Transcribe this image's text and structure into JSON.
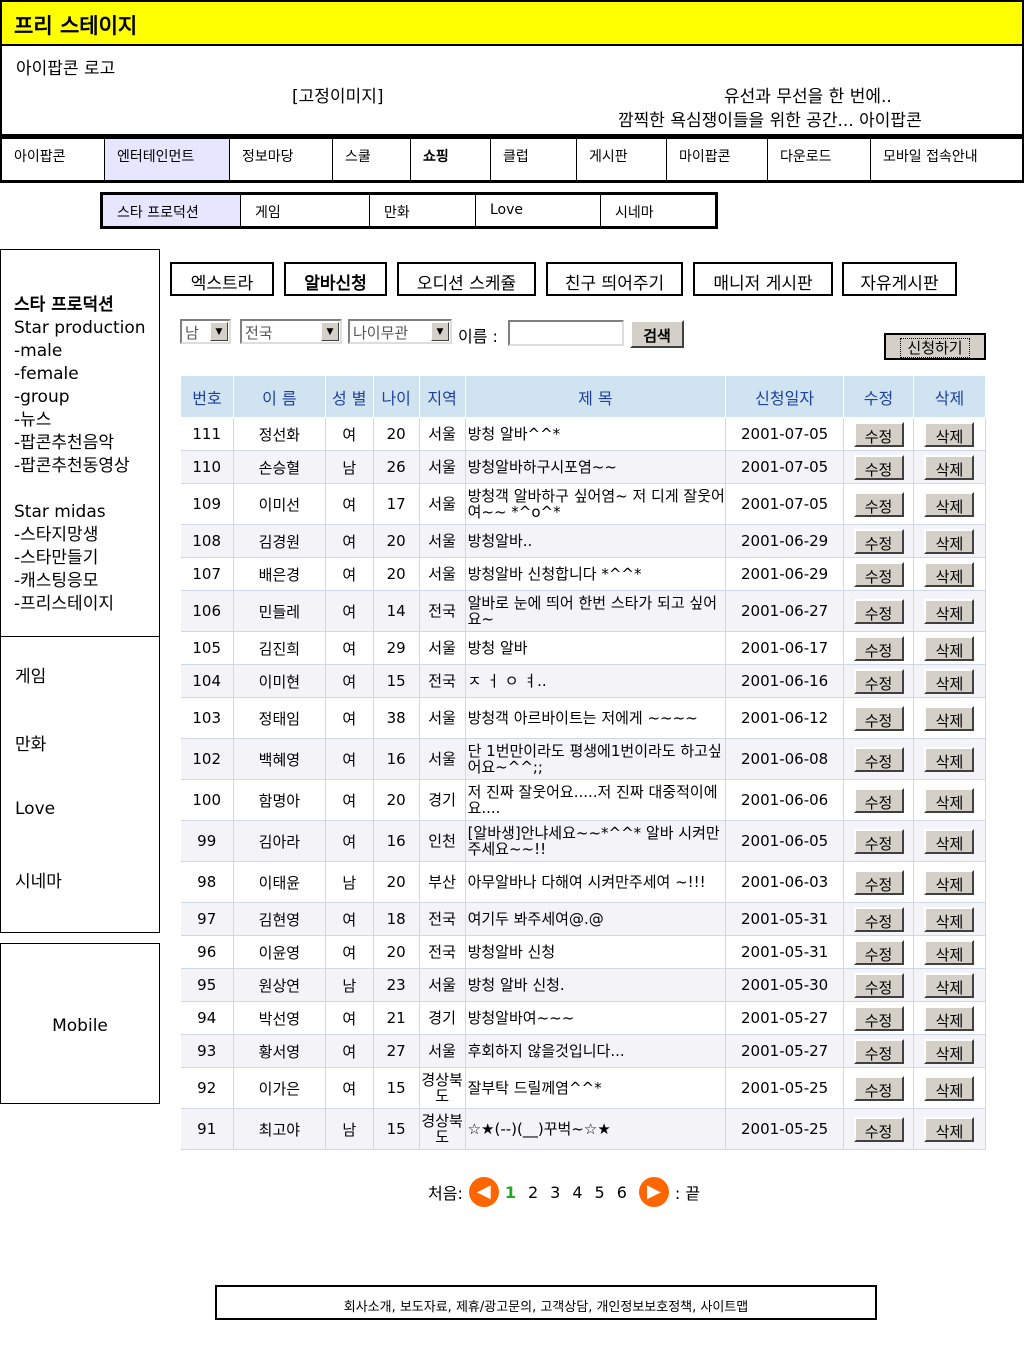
{
  "site_title": "프리 스테이지",
  "header": {
    "logo_label": "아이팝콘 로고",
    "fixed_image": "[고정이미지]",
    "slogan_line1": "유선과 무선을 한 번에..",
    "slogan_line2": "깜찍한 욕심쟁이들을 위한 공간... 아이팝콘"
  },
  "main_nav": [
    "아이팝콘",
    "엔터테인먼트",
    "정보마당",
    "스쿨",
    "쇼핑",
    "클럽",
    "게시판",
    "마이팝콘",
    "다운로드",
    "모바일 접속안내"
  ],
  "sub_nav": [
    "스타 프로덕션",
    "게임",
    "만화",
    "Love",
    "시네마"
  ],
  "sidebar": {
    "title": "스타 프로덕션",
    "group1": [
      "Star production",
      "-male",
      "-female",
      "-group",
      "-뉴스",
      "-팝콘추천음악",
      "-팝콘추천동영상"
    ],
    "group2": [
      "Star midas",
      "-스타지망생",
      "-스타만들기",
      "-캐스팅응모",
      "-프리스테이지"
    ],
    "menu": [
      "게임",
      "만화",
      "Love",
      "시네마"
    ],
    "mobile": "Mobile"
  },
  "tabs": [
    "엑스트라",
    "알바신청",
    "오디션 스케쥴",
    "친구 띄어주기",
    "매니저 게시판",
    "자유게시판"
  ],
  "filters": {
    "gender": "남",
    "region": "전국",
    "age": "나이무관",
    "name_label": "이름 :",
    "search_label": "검색",
    "apply_label": "신청하기"
  },
  "table": {
    "headers": [
      "번호",
      "이 름",
      "성 별",
      "나이",
      "지역",
      "제 목",
      "신청일자",
      "수정",
      "삭제"
    ],
    "edit_label": "수정",
    "delete_label": "삭제",
    "rows": [
      {
        "no": "111",
        "name": "정선화",
        "gender": "여",
        "age": "20",
        "region": "서울",
        "title": "방청 알바^^*",
        "date": "2001-07-05"
      },
      {
        "no": "110",
        "name": "손승혈",
        "gender": "남",
        "age": "26",
        "region": "서울",
        "title": "방청알바하구시포염~~",
        "date": "2001-07-05"
      },
      {
        "no": "109",
        "name": "이미선",
        "gender": "여",
        "age": "17",
        "region": "서울",
        "title": "방청객 알바하구 싶어염~ 저 디게 잘웃어여~~ *^o^*",
        "date": "2001-07-05"
      },
      {
        "no": "108",
        "name": "김경원",
        "gender": "여",
        "age": "20",
        "region": "서울",
        "title": "방청알바..",
        "date": "2001-06-29"
      },
      {
        "no": "107",
        "name": "배은경",
        "gender": "여",
        "age": "20",
        "region": "서울",
        "title": "방청알바 신청합니다 *^^*",
        "date": "2001-06-29"
      },
      {
        "no": "106",
        "name": "민들레",
        "gender": "여",
        "age": "14",
        "region": "전국",
        "title": "알바로 눈에 띄어 한번 스타가 되고 싶어요~",
        "date": "2001-06-27"
      },
      {
        "no": "105",
        "name": "김진희",
        "gender": "여",
        "age": "29",
        "region": "서울",
        "title": "방청 알바",
        "date": "2001-06-17"
      },
      {
        "no": "104",
        "name": "이미현",
        "gender": "여",
        "age": "15",
        "region": "전국",
        "title": "ㅈ ㅓ ㅇ ㅕ..",
        "date": "2001-06-16"
      },
      {
        "no": "103",
        "name": "정태임",
        "gender": "여",
        "age": "38",
        "region": "서울",
        "title": "방청객 아르바이트는 저에게 ~~~~",
        "date": "2001-06-12"
      },
      {
        "no": "102",
        "name": "백혜영",
        "gender": "여",
        "age": "16",
        "region": "서울",
        "title": "단 1번만이라도 평생에1번이라도 하고싶어요~^^;;",
        "date": "2001-06-08"
      },
      {
        "no": "100",
        "name": "함명아",
        "gender": "여",
        "age": "20",
        "region": "경기",
        "title": "저 진짜 잘웃어요.....저 진짜 대중적이에요....",
        "date": "2001-06-06"
      },
      {
        "no": "99",
        "name": "김아라",
        "gender": "여",
        "age": "16",
        "region": "인천",
        "title": "[알바생]안냐세요~~*^^* 알바 시켜만 주세요~~!!",
        "date": "2001-06-05"
      },
      {
        "no": "98",
        "name": "이태윤",
        "gender": "남",
        "age": "20",
        "region": "부산",
        "title": "아무알바나 다해여 시켜만주세여 ~!!!",
        "date": "2001-06-03"
      },
      {
        "no": "97",
        "name": "김현영",
        "gender": "여",
        "age": "18",
        "region": "전국",
        "title": "여기두 봐주세여@.@",
        "date": "2001-05-31"
      },
      {
        "no": "96",
        "name": "이윤영",
        "gender": "여",
        "age": "20",
        "region": "전국",
        "title": "방청알바 신청",
        "date": "2001-05-31"
      },
      {
        "no": "95",
        "name": "원상연",
        "gender": "남",
        "age": "23",
        "region": "서울",
        "title": "방청 알바 신청.",
        "date": "2001-05-30"
      },
      {
        "no": "94",
        "name": "박선영",
        "gender": "여",
        "age": "21",
        "region": "경기",
        "title": "방청알바여~~~",
        "date": "2001-05-27"
      },
      {
        "no": "93",
        "name": "황서영",
        "gender": "여",
        "age": "27",
        "region": "서울",
        "title": "후회하지 않을것입니다...",
        "date": "2001-05-27"
      },
      {
        "no": "92",
        "name": "이가은",
        "gender": "여",
        "age": "15",
        "region": "경상북도",
        "title": "잘부탁 드릴께염^^*",
        "date": "2001-05-25"
      },
      {
        "no": "91",
        "name": "최고야",
        "gender": "남",
        "age": "15",
        "region": "경상북도",
        "title": "☆★(--)(__)꾸벅~☆★",
        "date": "2001-05-25"
      }
    ]
  },
  "pagination": {
    "first_label": "처음:",
    "pages": [
      "1",
      "2",
      "3",
      "4",
      "5",
      "6"
    ],
    "current": "1",
    "last_label": ": 끝"
  },
  "footer": "회사소개, 보도자료, 제휴/광고문의, 고객상담, 개인정보보호정책, 사이트맵",
  "colors": {
    "title_bar": "#ffff00",
    "active_nav": "#e6e6ff",
    "table_header": "#cfe4f0",
    "pagination_arrow": "#ff6600"
  }
}
